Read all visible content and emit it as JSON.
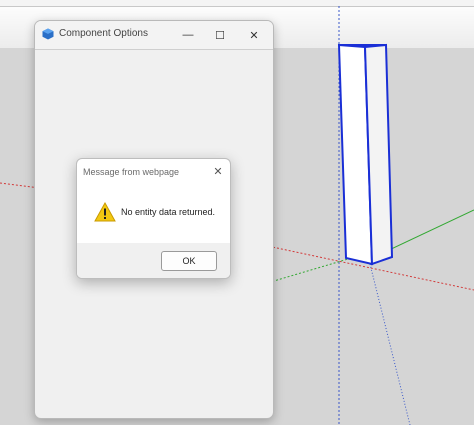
{
  "window": {
    "title": "Component Options",
    "icon": "cube-icon",
    "controls": {
      "minimize": "—",
      "maximize": "☐",
      "close": "✕"
    }
  },
  "dialog": {
    "title": "Message from webpage",
    "close_glyph": "✕",
    "message": "No entity data returned.",
    "icon": "warning-icon",
    "ok_label": "OK"
  },
  "colors": {
    "accent_blue": "#1a2fd6",
    "warning_yellow": "#f2c811",
    "axis_red": "#d23a3a",
    "axis_green": "#32a832"
  }
}
